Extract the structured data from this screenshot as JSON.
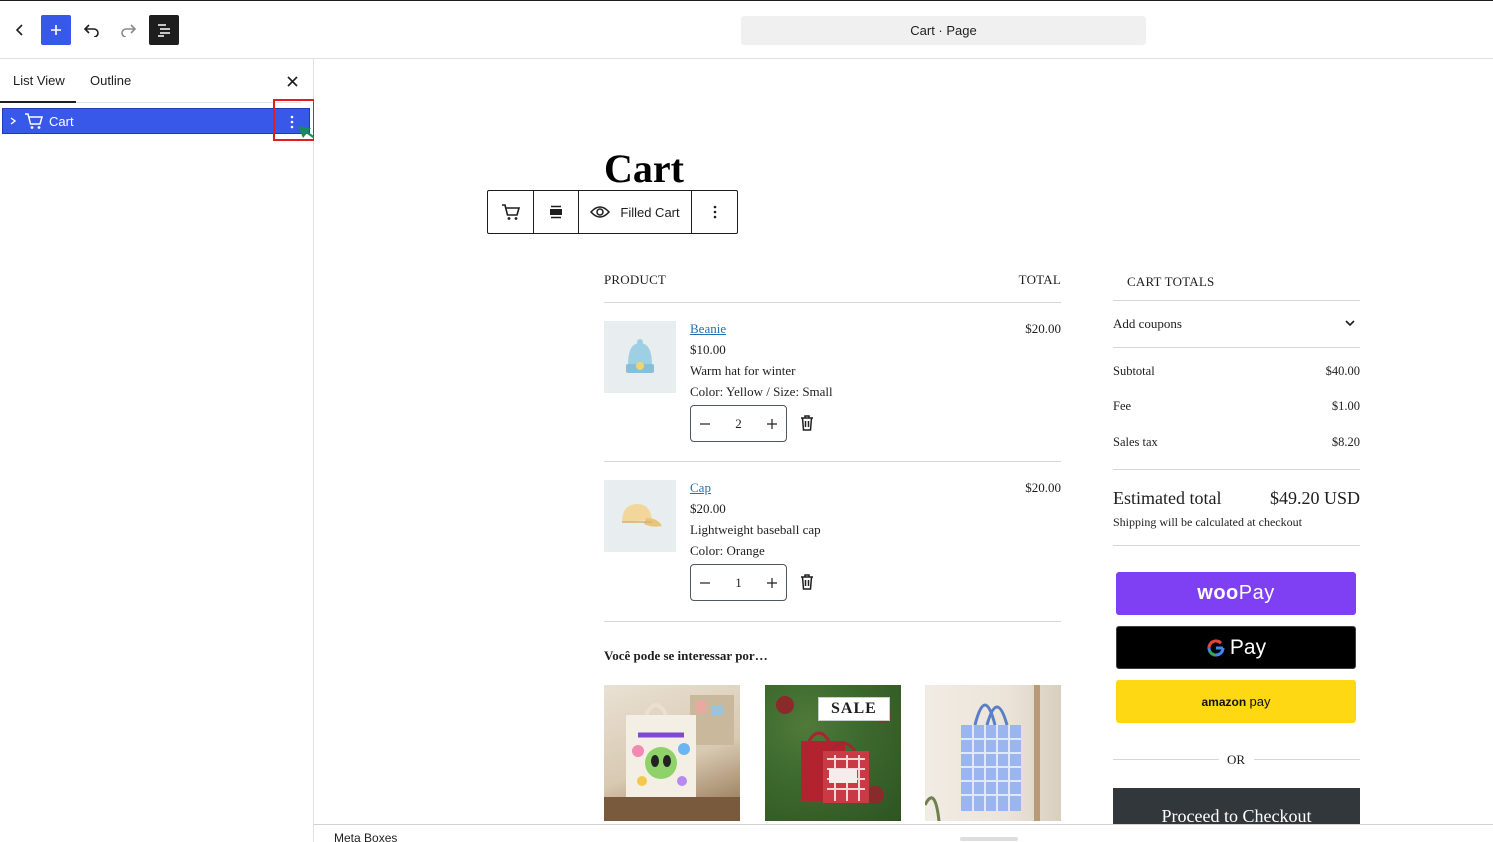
{
  "topbar": {
    "document_title": "Cart · Page"
  },
  "sidebar": {
    "tabs": [
      {
        "label": "List View"
      },
      {
        "label": "Outline"
      }
    ],
    "list_view": {
      "items": [
        {
          "label": "Cart"
        }
      ]
    }
  },
  "canvas": {
    "page_title": "Cart",
    "block_toolbar": {
      "view_label": "Filled Cart"
    },
    "cart": {
      "headers": {
        "product": "PRODUCT",
        "total": "TOTAL"
      },
      "items": [
        {
          "name": "Beanie",
          "price": "$10.00",
          "description": "Warm hat for winter",
          "variation": "Color: Yellow / Size: Small",
          "quantity": "2",
          "line_total": "$20.00"
        },
        {
          "name": "Cap",
          "price": "$20.00",
          "description": "Lightweight baseball cap",
          "variation": "Color: Orange",
          "quantity": "1",
          "line_total": "$20.00"
        }
      ]
    },
    "cross_sells": {
      "title": "Você pode se interessar por…",
      "sale_badge": "SALE"
    },
    "totals": {
      "heading": "CART TOTALS",
      "coupons_label": "Add coupons",
      "rows": [
        {
          "label": "Subtotal",
          "value": "$40.00"
        },
        {
          "label": "Fee",
          "value": "$1.00"
        },
        {
          "label": "Sales tax",
          "value": "$8.20"
        }
      ],
      "estimated_label": "Estimated total",
      "estimated_value": "$49.20 USD",
      "shipping_note": "Shipping will be calculated at checkout",
      "woopay_brand": "woo",
      "woopay_pay": "Pay",
      "gpay_label": "Pay",
      "amazon_brand": "amazon",
      "amazon_pay": "pay",
      "or_label": "OR",
      "checkout_label": "Proceed to Checkout"
    }
  },
  "metabar": {
    "label": "Meta Boxes"
  },
  "colors": {
    "accent": "#3858e9",
    "woopay": "#7f3ff2",
    "amazon": "#ffd814",
    "checkout": "#32373c",
    "highlight": "#e31b23",
    "arrow": "#1a8a5a"
  }
}
